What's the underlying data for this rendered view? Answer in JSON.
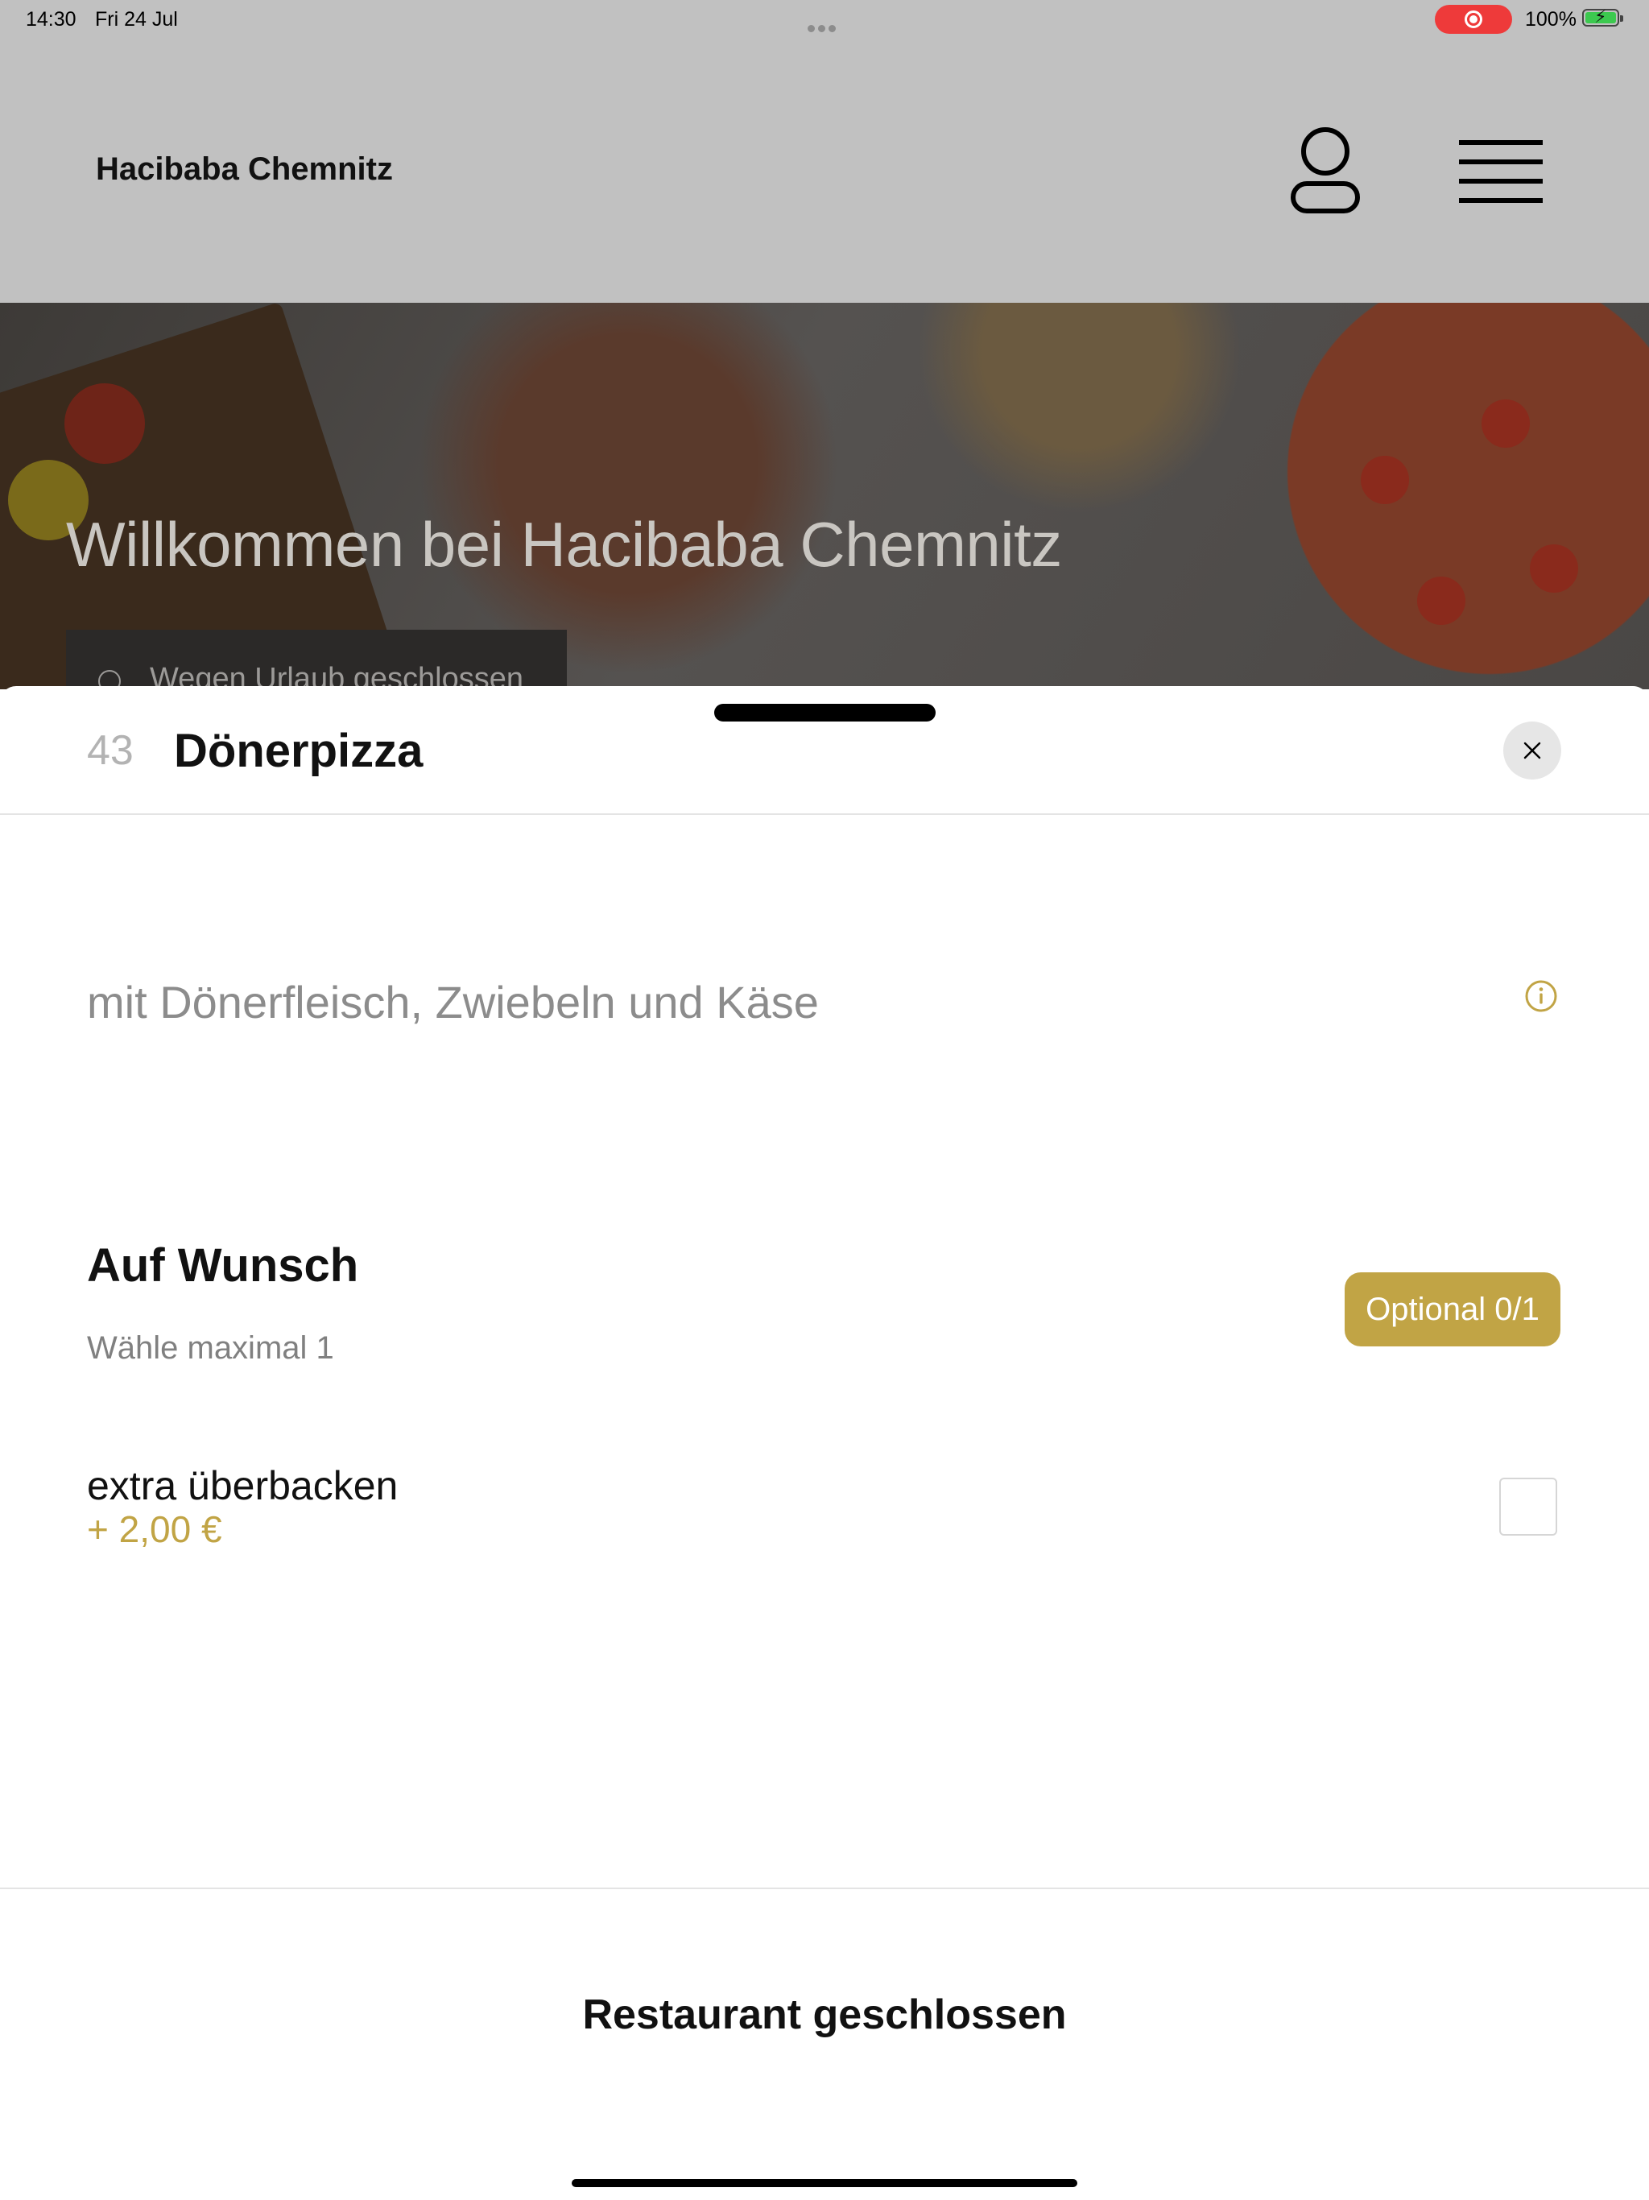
{
  "status_bar": {
    "time": "14:30",
    "date": "Fri 24 Jul",
    "battery_percent": "100%",
    "battery_level": 1.0,
    "recording_indicator_color": "#ee3a3a"
  },
  "header": {
    "title": "Hacibaba Chemnitz",
    "icons": [
      "user-icon",
      "menu-icon"
    ]
  },
  "hero": {
    "title": "Willkommen bei Hacibaba Chemnitz",
    "closed_badge": "Wegen Urlaub geschlossen"
  },
  "sheet": {
    "item_number": "43",
    "item_title": "Dönerpizza",
    "description": "mit Dönerfleisch, Zwiebeln und Käse",
    "option_group": {
      "title": "Auf Wunsch",
      "subtitle": "Wähle maximal 1",
      "badge": "Optional 0/1",
      "options": [
        {
          "label": "extra überbacken",
          "price": "+ 2,00 €",
          "checked": false
        }
      ]
    },
    "footer_label": "Restaurant geschlossen"
  },
  "colors": {
    "accent": "#c1a445",
    "header_bg": "#c1c1c1",
    "close_button_bg": "#e6e6e6"
  }
}
